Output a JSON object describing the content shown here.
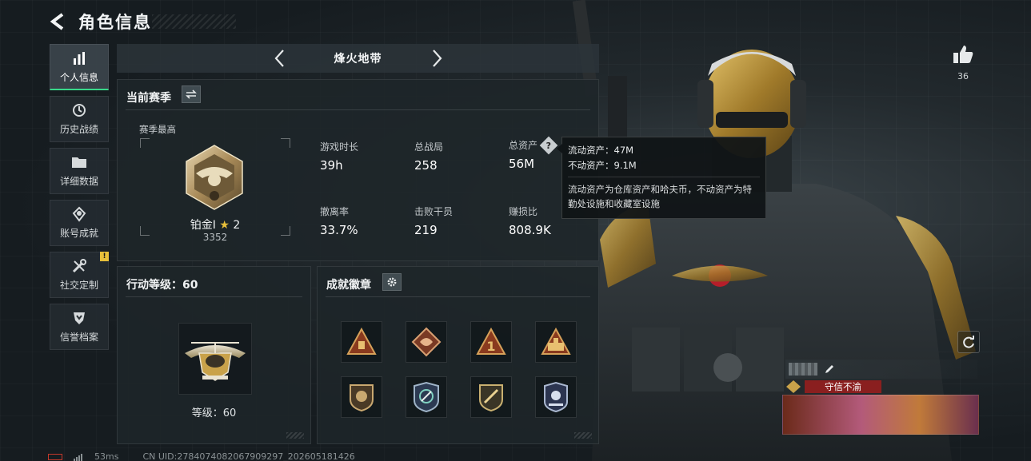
{
  "header": {
    "title": "角色信息"
  },
  "sidebar": {
    "items": [
      {
        "label": "个人信息",
        "icon": "bar-chart-icon",
        "active": true
      },
      {
        "label": "历史战绩",
        "icon": "history-icon"
      },
      {
        "label": "详细数据",
        "icon": "folder-icon"
      },
      {
        "label": "账号成就",
        "icon": "achievement-icon"
      },
      {
        "label": "社交定制",
        "icon": "tools-icon",
        "badge": "!"
      },
      {
        "label": "信誉档案",
        "icon": "shield-icon"
      }
    ]
  },
  "mode": {
    "name": "烽火地带"
  },
  "season": {
    "title": "当前赛季",
    "subtitle": "赛季最高",
    "rank_name": "铂金I",
    "rank_stars": "2",
    "rank_score": "3352",
    "stats": [
      {
        "label": "游戏时长",
        "value": "39h"
      },
      {
        "label": "总战局",
        "value": "258"
      },
      {
        "label": "总资产",
        "value": "56M"
      },
      {
        "label": "撤离率",
        "value": "33.7%"
      },
      {
        "label": "击败干员",
        "value": "219"
      },
      {
        "label": "赚损比",
        "value": "808.9K"
      }
    ]
  },
  "tooltip": {
    "liquid": "流动资产：47M",
    "fixed": "不动资产：9.1M",
    "note": "流动资产为仓库资产和哈夫币，不动资产为特勤处设施和收藏室设施"
  },
  "level": {
    "title": "行动等级：60",
    "text": "等级：60"
  },
  "badges": {
    "title": "成就徽章",
    "items": [
      "badge-1",
      "badge-2",
      "badge-3",
      "badge-4",
      "badge-5",
      "badge-6",
      "badge-7",
      "badge-8"
    ]
  },
  "likes": {
    "count": "36"
  },
  "player_card": {
    "title": "守信不渝"
  },
  "footer": {
    "ping": "53ms",
    "uid": "CN UID:2784074082067909297_202605181426"
  },
  "colors": {
    "accent": "#39d98a",
    "gold": "#c9a24a",
    "badge_red": "#8a1f1f",
    "warn": "#e8c03a"
  }
}
